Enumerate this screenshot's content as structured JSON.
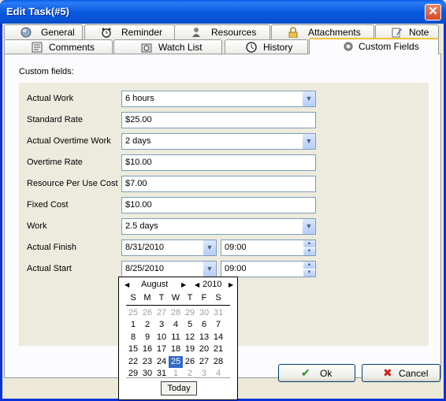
{
  "window": {
    "title": "Edit Task(#5)",
    "close_glyph": "✕"
  },
  "tabs_row1": [
    {
      "label": "General",
      "icon": "globe-icon"
    },
    {
      "label": "Reminder",
      "icon": "alarm-clock-icon"
    },
    {
      "label": "Resources",
      "icon": "people-icon"
    },
    {
      "label": "Attachments",
      "icon": "lock-icon"
    },
    {
      "label": "Note",
      "icon": "note-pen-icon"
    }
  ],
  "tabs_row2": [
    {
      "label": "Comments",
      "icon": "comment-icon"
    },
    {
      "label": "Watch List",
      "icon": "watch-list-icon"
    },
    {
      "label": "History",
      "icon": "history-icon"
    },
    {
      "label": "Custom Fields",
      "icon": "gear-icon"
    }
  ],
  "panel": {
    "caption": "Custom fields:"
  },
  "fields": [
    {
      "label": "Actual Work",
      "value": "6 hours",
      "type": "combo"
    },
    {
      "label": "Standard Rate",
      "value": "$25.00",
      "type": "text"
    },
    {
      "label": "Actual Overtime Work",
      "value": "2 days",
      "type": "combo"
    },
    {
      "label": "Overtime Rate",
      "value": "$10.00",
      "type": "text"
    },
    {
      "label": "Resource Per Use Cost",
      "value": "$7.00",
      "type": "text"
    },
    {
      "label": "Fixed Cost",
      "value": "$10.00",
      "type": "text"
    },
    {
      "label": "Work",
      "value": "2.5 days",
      "type": "combo"
    },
    {
      "label": "Actual Finish",
      "value": "8/31/2010",
      "time": "09:00",
      "type": "datetime"
    },
    {
      "label": "Actual Start",
      "value": "8/25/2010",
      "time": "09:00",
      "type": "datetime"
    }
  ],
  "calendar": {
    "month": "August",
    "year": "2010",
    "weekdays": [
      "S",
      "M",
      "T",
      "W",
      "T",
      "F",
      "S"
    ],
    "weeks": [
      [
        {
          "d": "25",
          "o": 1
        },
        {
          "d": "26",
          "o": 1
        },
        {
          "d": "27",
          "o": 1
        },
        {
          "d": "28",
          "o": 1
        },
        {
          "d": "29",
          "o": 1
        },
        {
          "d": "30",
          "o": 1
        },
        {
          "d": "31",
          "o": 1
        }
      ],
      [
        {
          "d": "1"
        },
        {
          "d": "2"
        },
        {
          "d": "3"
        },
        {
          "d": "4"
        },
        {
          "d": "5"
        },
        {
          "d": "6"
        },
        {
          "d": "7"
        }
      ],
      [
        {
          "d": "8"
        },
        {
          "d": "9"
        },
        {
          "d": "10"
        },
        {
          "d": "11"
        },
        {
          "d": "12"
        },
        {
          "d": "13"
        },
        {
          "d": "14"
        }
      ],
      [
        {
          "d": "15"
        },
        {
          "d": "16"
        },
        {
          "d": "17"
        },
        {
          "d": "18"
        },
        {
          "d": "19"
        },
        {
          "d": "20"
        },
        {
          "d": "21"
        }
      ],
      [
        {
          "d": "22"
        },
        {
          "d": "23"
        },
        {
          "d": "24"
        },
        {
          "d": "25",
          "sel": 1
        },
        {
          "d": "26"
        },
        {
          "d": "27"
        },
        {
          "d": "28"
        }
      ],
      [
        {
          "d": "29"
        },
        {
          "d": "30"
        },
        {
          "d": "31"
        },
        {
          "d": "1",
          "o": 1
        },
        {
          "d": "2",
          "o": 1
        },
        {
          "d": "3",
          "o": 1
        },
        {
          "d": "4",
          "o": 1
        }
      ]
    ],
    "today_label": "Today"
  },
  "buttons": {
    "ok": "Ok",
    "cancel": "Cancel"
  },
  "colors": {
    "title_bar": "#0a5ae0",
    "selected_day": "#316ac5",
    "active_tab_highlight": "#f7c13a"
  }
}
